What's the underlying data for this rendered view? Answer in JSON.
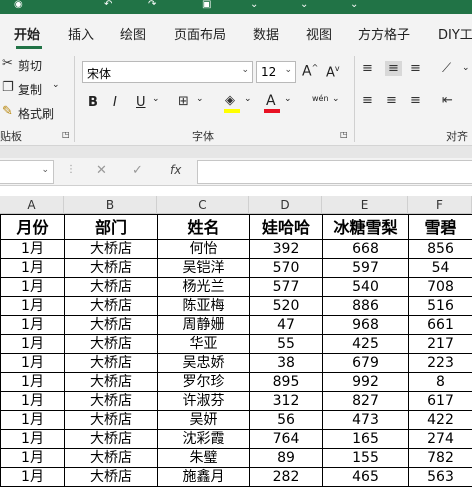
{
  "ribbon_tabs": [
    "开始",
    "插入",
    "绘图",
    "页面布局",
    "数据",
    "视图",
    "方方格子",
    "DIY工具"
  ],
  "clipboard": {
    "cut": "剪切",
    "copy": "复制",
    "format_painter": "格式刷",
    "group": "贴板"
  },
  "font": {
    "name": "宋体",
    "size": "12",
    "group": "字体",
    "bold": "B",
    "italic": "I",
    "underline": "U",
    "grow": "A",
    "shrink": "A",
    "wen": "wén"
  },
  "align": {
    "group": "对齐"
  },
  "formula_bar": {
    "fx": "fx",
    "value": ""
  },
  "column_headers": [
    "A",
    "B",
    "C",
    "D",
    "E",
    "F"
  ],
  "sheet": {
    "headers": [
      "月份",
      "部门",
      "姓名",
      "娃哈哈",
      "冰糖雪梨",
      "雪碧"
    ],
    "rows": [
      [
        "1月",
        "大桥店",
        "何怡",
        "392",
        "668",
        "856"
      ],
      [
        "1月",
        "大桥店",
        "吴铠洋",
        "570",
        "597",
        "54"
      ],
      [
        "1月",
        "大桥店",
        "杨光兰",
        "577",
        "540",
        "708"
      ],
      [
        "1月",
        "大桥店",
        "陈亚梅",
        "520",
        "886",
        "516"
      ],
      [
        "1月",
        "大桥店",
        "周静姗",
        "47",
        "968",
        "661"
      ],
      [
        "1月",
        "大桥店",
        "华亚",
        "55",
        "425",
        "217"
      ],
      [
        "1月",
        "大桥店",
        "吴忠娇",
        "38",
        "679",
        "223"
      ],
      [
        "1月",
        "大桥店",
        "罗尔珍",
        "895",
        "992",
        "8"
      ],
      [
        "1月",
        "大桥店",
        "许淑芬",
        "312",
        "827",
        "617"
      ],
      [
        "1月",
        "大桥店",
        "吴妍",
        "56",
        "473",
        "422"
      ],
      [
        "1月",
        "大桥店",
        "沈彩霞",
        "764",
        "165",
        "274"
      ],
      [
        "1月",
        "大桥店",
        "朱璧",
        "89",
        "155",
        "782"
      ],
      [
        "1月",
        "大桥店",
        "施鑫月",
        "282",
        "465",
        "563"
      ]
    ]
  }
}
